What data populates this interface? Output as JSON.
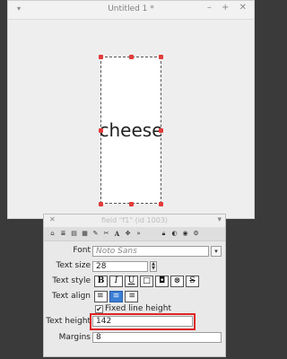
{
  "main_window": {
    "title": "Untitled 1 *",
    "controls": {
      "collapse": "▾",
      "minimize": "–",
      "maximize": "+",
      "close": "✕"
    }
  },
  "canvas": {
    "card_text": "cheese"
  },
  "inspector": {
    "title": "field \"f1\" (id 1003)",
    "close": "✕",
    "menu": "▾",
    "toolbar_icons": [
      "home-icon",
      "list-icon",
      "grid-icon",
      "table-icon",
      "pencil-icon",
      "tools-icon",
      "text-icon",
      "arrows-icon",
      "forward-icon",
      "lock-icon",
      "palette-icon",
      "target-icon",
      "gear-icon"
    ],
    "fields": {
      "font": {
        "label": "Font",
        "placeholder": "Noto Sans"
      },
      "text_size": {
        "label": "Text size",
        "value": "28"
      },
      "text_style": {
        "label": "Text style",
        "buttons": [
          "B",
          "I",
          "U",
          "□",
          "◘",
          "⊗",
          "S"
        ]
      },
      "text_align": {
        "label": "Text align",
        "buttons": [
          "≡",
          "≡",
          "≡"
        ],
        "selected": 1
      },
      "fixed_line_height": {
        "label": "Fixed line height",
        "checked": true
      },
      "text_height": {
        "label": "Text height",
        "value": "142"
      },
      "margins": {
        "label": "Margins",
        "value": "8"
      }
    }
  },
  "colors": {
    "accent": "#3b7fd6",
    "highlight": "#e02424",
    "handle": "#e23b3b"
  }
}
